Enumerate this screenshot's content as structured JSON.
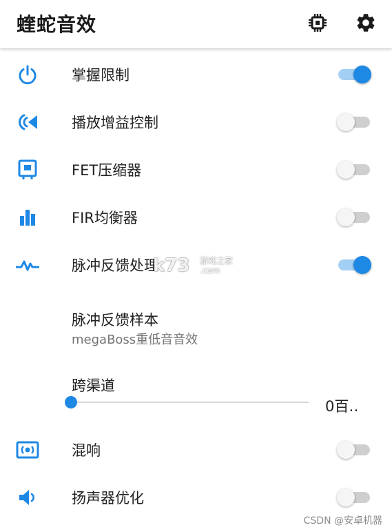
{
  "appbar": {
    "title": "蝰蛇音效",
    "chip_icon": "cpu-chip-icon",
    "settings_icon": "gear-icon"
  },
  "rows": [
    {
      "label": "掌握限制",
      "icon": "power-icon",
      "enabled": true
    },
    {
      "label": "播放增益控制",
      "icon": "volume-gain-icon",
      "enabled": false
    },
    {
      "label": "FET压缩器",
      "icon": "compressor-icon",
      "enabled": false
    },
    {
      "label": "FIR均衡器",
      "icon": "equalizer-bars-icon",
      "enabled": false
    },
    {
      "label": "脉冲反馈处理",
      "icon": "pulse-wave-icon",
      "enabled": true
    }
  ],
  "impulse_sample": {
    "title": "脉冲反馈样本",
    "value": "megaBoss重低音音效"
  },
  "crossfeed": {
    "label": "跨渠道",
    "value_text": "0百‥",
    "value": 0
  },
  "rows2": [
    {
      "label": "混响",
      "icon": "reverb-icon",
      "enabled": false
    },
    {
      "label": "扬声器优化",
      "icon": "speaker-icon",
      "enabled": false
    }
  ],
  "watermark": {
    "main": "k73",
    "sub_line1": "游戏之家",
    "sub_line2": ".com",
    "footer": "CSDN @安卓机器"
  },
  "colors": {
    "accent": "#1e88e5",
    "track_on": "#a3cff5",
    "track_off": "#cfcfcf"
  }
}
